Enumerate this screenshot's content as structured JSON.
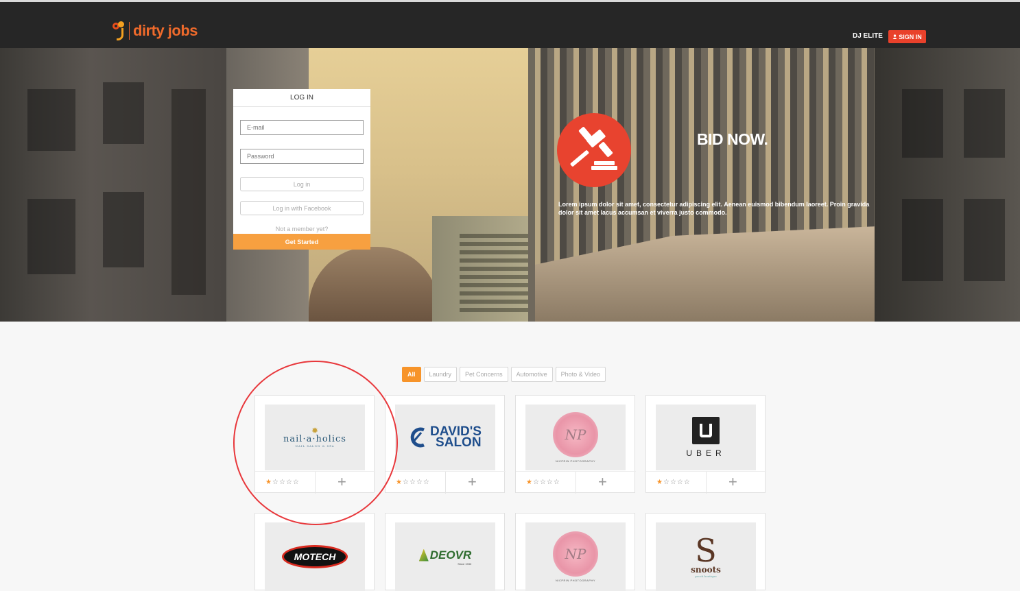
{
  "nav": {
    "logo_text": "dirty jobs",
    "elite_label": "DJ ELITE",
    "signin_label": "SIGN IN",
    "signin_icon": "user-icon",
    "accent_color": "#e9412b"
  },
  "login": {
    "title": "LOG IN",
    "email_placeholder": "E-mail",
    "password_placeholder": "Password",
    "login_button": "Log in",
    "facebook_button": "Log in with Facebook",
    "not_member": "Not a member yet?",
    "get_started": "Get Started"
  },
  "hero": {
    "icon": "gavel-icon",
    "title": "BID NOW.",
    "text": "Lorem ipsum dolor sit amet, consectetur adipiscing elit. Aenean euismod bibendum laoreet. Proin gravida dolor sit amet lacus accumsan et viverra justo commodo."
  },
  "filters": [
    {
      "label": "All",
      "active": true
    },
    {
      "label": "Laundry",
      "active": false
    },
    {
      "label": "Pet Concerns",
      "active": false
    },
    {
      "label": "Automotive",
      "active": false
    },
    {
      "label": "Photo & Video",
      "active": false
    }
  ],
  "cards": [
    {
      "name": "nail-a-holics",
      "logo_text": "nail·a·holics",
      "logo_sub": "NAIL SALON & SPA",
      "rating": 1,
      "max_rating": 5
    },
    {
      "name": "davids-salon",
      "logo_text_1": "DAVID'S",
      "logo_text_2": "SALON",
      "rating": 1,
      "max_rating": 5
    },
    {
      "name": "nicprin-photography",
      "logo_text": "NICPRIN PHOTOGRAPHY",
      "logo_mark": "NP",
      "rating": 1,
      "max_rating": 5
    },
    {
      "name": "uber",
      "logo_text": "UBER",
      "rating": 1,
      "max_rating": 5
    }
  ],
  "cards_row2": [
    {
      "name": "motech",
      "logo_text": "MOTECH"
    },
    {
      "name": "deovr",
      "logo_text": "DEOVR",
      "logo_sub": "Since 1933"
    },
    {
      "name": "nicprin-photography-2",
      "logo_text": "NICPRIN PHOTOGRAPHY",
      "logo_mark": "NP"
    },
    {
      "name": "snoots",
      "logo_text": "snoots",
      "logo_sub": "pooch boutique"
    }
  ],
  "card_add_label": "+",
  "star_on": "★",
  "star_off": "☆"
}
